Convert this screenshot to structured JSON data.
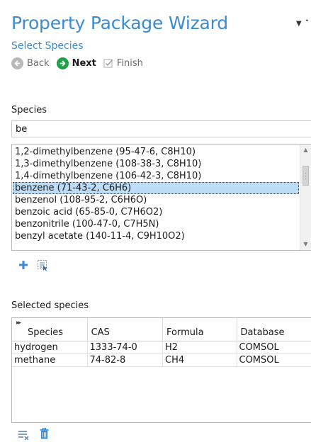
{
  "wizard": {
    "title": "Property Package Wizard",
    "subtitle": "Select Species"
  },
  "nav": {
    "back_label": "Back",
    "next_label": "Next",
    "finish_label": "Finish"
  },
  "species_section": {
    "label": "Species",
    "search_value": "be",
    "items": [
      "1,2-dimethylbenzene (95-47-6, C8H10)",
      "1,3-dimethylbenzene (108-38-3, C8H10)",
      "1,4-dimethylbenzene (106-42-3, C8H10)",
      "benzene (71-43-2, C6H6)",
      "benzenol (108-95-2, C6H6O)",
      "benzoic acid (65-85-0, C7H6O2)",
      "benzonitrile (100-47-0, C7H5N)",
      "benzyl acetate (140-11-4, C9H10O2)"
    ],
    "selected_index": 3
  },
  "selected_section": {
    "label": "Selected species",
    "columns": [
      "Species",
      "CAS",
      "Formula",
      "Database"
    ],
    "rows": [
      [
        "hydrogen",
        "1333-74-0",
        "H2",
        "COMSOL"
      ],
      [
        "methane",
        "74-82-8",
        "CH4",
        "COMSOL"
      ]
    ]
  },
  "colors": {
    "accent": "#3c8ad0",
    "selection": "#bcdcf7",
    "next_green": "#1ea04a"
  },
  "icons": {
    "add": "plus-icon",
    "browse": "select-from-list-icon",
    "clear": "clear-list-icon",
    "delete": "trash-icon"
  }
}
